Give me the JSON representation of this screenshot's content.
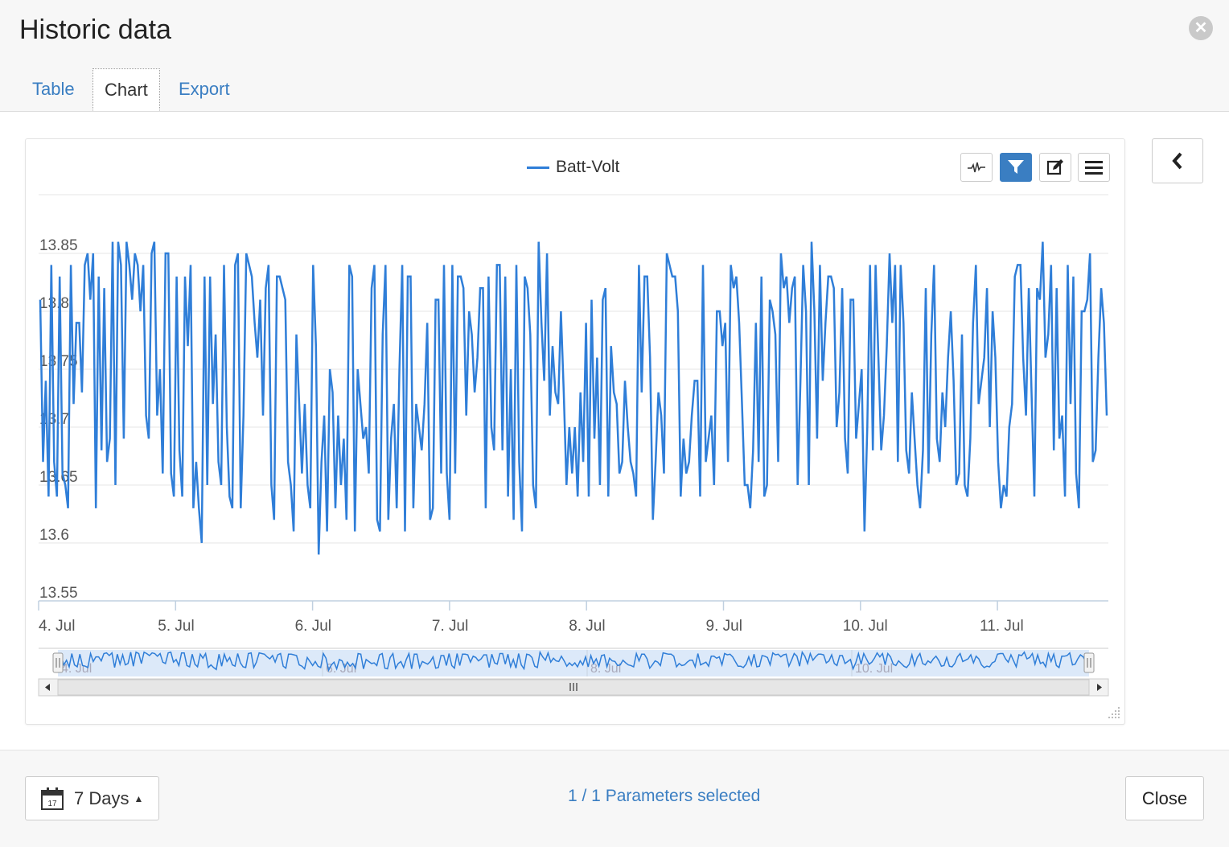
{
  "dialog": {
    "title": "Historic data",
    "close_icon": "close-circle-icon"
  },
  "tabs": [
    {
      "label": "Table",
      "active": false
    },
    {
      "label": "Chart",
      "active": true
    },
    {
      "label": "Export",
      "active": false
    }
  ],
  "toolbar": {
    "buttons": [
      {
        "icon": "line-chart-icon",
        "active": false
      },
      {
        "icon": "filter-icon",
        "active": true
      },
      {
        "icon": "edit-icon",
        "active": false
      },
      {
        "icon": "menu-icon",
        "active": false
      }
    ],
    "collapse_icon": "chevron-left-icon"
  },
  "colors": {
    "series": "#2f7ed8",
    "accent": "#3a7ec2",
    "navigator_fill": "#dce9f9"
  },
  "chart_data": {
    "type": "line",
    "legend": "Batt-Volt",
    "series": [
      {
        "name": "Batt-Volt",
        "x_range": [
          "4. Jul",
          "11. Jul"
        ]
      }
    ],
    "ylim": [
      13.55,
      13.87
    ],
    "yticks": [
      "13.85",
      "13.8",
      "13.75",
      "13.7",
      "13.65",
      "13.6",
      "13.55"
    ],
    "xticks": [
      "4. Jul",
      "5. Jul",
      "6. Jul",
      "7. Jul",
      "8. Jul",
      "9. Jul",
      "10. Jul",
      "11. Jul"
    ],
    "navigator_ticks": [
      "4. Jul",
      "6. Jul",
      "8. Jul",
      "10. Jul"
    ],
    "values": [
      13.81,
      13.67,
      13.74,
      13.64,
      13.84,
      13.67,
      13.64,
      13.83,
      13.66,
      13.65,
      13.63,
      13.84,
      13.72,
      13.79,
      13.79,
      13.73,
      13.84,
      13.85,
      13.81,
      13.85,
      13.63,
      13.83,
      13.68,
      13.82,
      13.67,
      13.69,
      13.86,
      13.65,
      13.86,
      13.84,
      13.69,
      13.86,
      13.84,
      13.81,
      13.85,
      13.84,
      13.8,
      13.84,
      13.71,
      13.69,
      13.85,
      13.86,
      13.71,
      13.75,
      13.66,
      13.85,
      13.85,
      13.66,
      13.64,
      13.83,
      13.68,
      13.64,
      13.83,
      13.77,
      13.84,
      13.63,
      13.67,
      13.63,
      13.6,
      13.83,
      13.65,
      13.83,
      13.72,
      13.78,
      13.67,
      13.65,
      13.84,
      13.7,
      13.64,
      13.63,
      13.84,
      13.85,
      13.63,
      13.71,
      13.85,
      13.84,
      13.83,
      13.79,
      13.76,
      13.81,
      13.71,
      13.82,
      13.84,
      13.65,
      13.62,
      13.83,
      13.83,
      13.82,
      13.81,
      13.67,
      13.65,
      13.61,
      13.78,
      13.72,
      13.66,
      13.72,
      13.65,
      13.63,
      13.84,
      13.77,
      13.59,
      13.67,
      13.71,
      13.61,
      13.75,
      13.73,
      13.63,
      13.71,
      13.65,
      13.69,
      13.62,
      13.84,
      13.83,
      13.61,
      13.75,
      13.72,
      13.69,
      13.7,
      13.66,
      13.82,
      13.84,
      13.62,
      13.61,
      13.78,
      13.84,
      13.62,
      13.69,
      13.72,
      13.63,
      13.75,
      13.84,
      13.61,
      13.83,
      13.83,
      13.63,
      13.72,
      13.7,
      13.68,
      13.72,
      13.79,
      13.62,
      13.63,
      13.81,
      13.81,
      13.66,
      13.84,
      13.66,
      13.62,
      13.84,
      13.66,
      13.83,
      13.83,
      13.82,
      13.71,
      13.8,
      13.78,
      13.73,
      13.76,
      13.82,
      13.82,
      13.63,
      13.83,
      13.7,
      13.68,
      13.84,
      13.84,
      13.68,
      13.83,
      13.64,
      13.75,
      13.62,
      13.84,
      13.67,
      13.61,
      13.83,
      13.82,
      13.78,
      13.65,
      13.63,
      13.86,
      13.79,
      13.74,
      13.85,
      13.71,
      13.77,
      13.73,
      13.72,
      13.8,
      13.73,
      13.65,
      13.7,
      13.66,
      13.7,
      13.64,
      13.73,
      13.67,
      13.79,
      13.64,
      13.81,
      13.69,
      13.76,
      13.65,
      13.81,
      13.82,
      13.64,
      13.77,
      13.73,
      13.72,
      13.66,
      13.67,
      13.74,
      13.7,
      13.67,
      13.66,
      13.64,
      13.84,
      13.73,
      13.83,
      13.83,
      13.76,
      13.62,
      13.67,
      13.73,
      13.71,
      13.66,
      13.85,
      13.84,
      13.83,
      13.83,
      13.8,
      13.64,
      13.69,
      13.66,
      13.67,
      13.71,
      13.74,
      13.74,
      13.64,
      13.84,
      13.67,
      13.69,
      13.71,
      13.65,
      13.8,
      13.8,
      13.77,
      13.79,
      13.67,
      13.84,
      13.82,
      13.83,
      13.79,
      13.72,
      13.65,
      13.65,
      13.63,
      13.68,
      13.79,
      13.67,
      13.83,
      13.64,
      13.65,
      13.81,
      13.8,
      13.78,
      13.67,
      13.85,
      13.82,
      13.83,
      13.79,
      13.82,
      13.83,
      13.65,
      13.74,
      13.84,
      13.8,
      13.65,
      13.86,
      13.8,
      13.69,
      13.84,
      13.74,
      13.79,
      13.83,
      13.83,
      13.82,
      13.7,
      13.73,
      13.82,
      13.69,
      13.66,
      13.81,
      13.81,
      13.69,
      13.72,
      13.75,
      13.61,
      13.7,
      13.84,
      13.68,
      13.84,
      13.76,
      13.68,
      13.71,
      13.77,
      13.85,
      13.79,
      13.84,
      13.67,
      13.84,
      13.79,
      13.68,
      13.66,
      13.73,
      13.69,
      13.65,
      13.63,
      13.68,
      13.82,
      13.66,
      13.78,
      13.84,
      13.69,
      13.67,
      13.73,
      13.7,
      13.76,
      13.8,
      13.74,
      13.65,
      13.66,
      13.78,
      13.65,
      13.64,
      13.69,
      13.79,
      13.84,
      13.72,
      13.74,
      13.76,
      13.82,
      13.7,
      13.8,
      13.76,
      13.67,
      13.63,
      13.65,
      13.64,
      13.7,
      13.72,
      13.83,
      13.84,
      13.84,
      13.76,
      13.71,
      13.82,
      13.73,
      13.64,
      13.82,
      13.81,
      13.86,
      13.76,
      13.78,
      13.84,
      13.68,
      13.82,
      13.69,
      13.71,
      13.64,
      13.84,
      13.72,
      13.83,
      13.66,
      13.63,
      13.8,
      13.8,
      13.81,
      13.85,
      13.67,
      13.68,
      13.76,
      13.82,
      13.79,
      13.71
    ]
  },
  "footer": {
    "range_label": "7 Days",
    "calendar_icon": "calendar-icon",
    "calendar_day": "17",
    "params_text": "1 / 1 Parameters selected",
    "close_label": "Close"
  }
}
